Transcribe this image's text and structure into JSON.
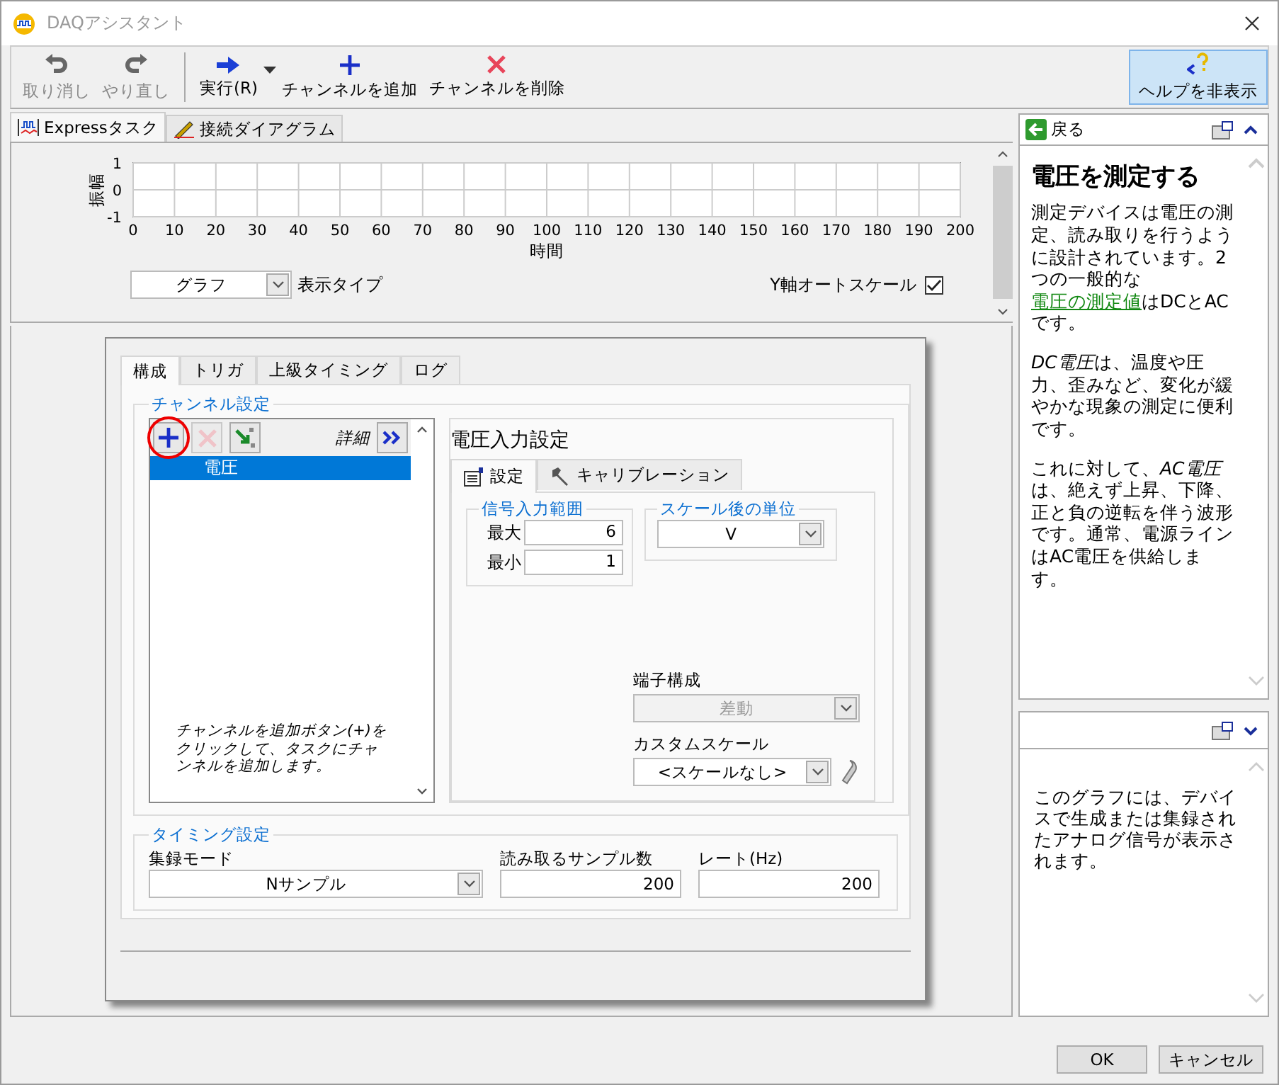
{
  "window": {
    "title": "DAQアシスタント"
  },
  "toolbar": {
    "items": [
      {
        "kind": "undo",
        "label": "取り消し",
        "disabled": true,
        "menu": false
      },
      {
        "kind": "redo",
        "label": "やり直し",
        "disabled": true,
        "menu": false
      },
      {
        "kind": "run",
        "label": "実行(R)",
        "disabled": false,
        "menu": true
      },
      {
        "kind": "add",
        "label": "チャンネルを追加",
        "disabled": false,
        "menu": false
      },
      {
        "kind": "delete",
        "label": "チャンネルを削除",
        "disabled": false,
        "menu": false
      }
    ],
    "help_toggle": {
      "label": "ヘルプを非表示",
      "selected": true
    }
  },
  "view_tabs": [
    {
      "kind": "express",
      "label": "Expressタスク",
      "selected": true
    },
    {
      "kind": "diagram",
      "label": "接続ダイアグラム",
      "selected": false
    }
  ],
  "graph": {
    "chart_data": {
      "type": "line",
      "xlabel": "時間",
      "ylabel": "振幅",
      "xlim": [
        0,
        200
      ],
      "ylim": [
        -1,
        1
      ],
      "xticks": [
        0,
        10,
        20,
        30,
        40,
        50,
        60,
        70,
        80,
        90,
        100,
        110,
        120,
        130,
        140,
        150,
        160,
        170,
        180,
        190,
        200
      ],
      "yticks": [
        -1,
        0,
        1
      ],
      "grid": true
    },
    "display_type": {
      "value": "グラフ",
      "label": "表示タイプ"
    },
    "autoscale": {
      "label": "Y軸オートスケール",
      "checked": true
    }
  },
  "config_tabs": [
    {
      "label": "構成",
      "selected": true
    },
    {
      "label": "トリガ",
      "selected": false
    },
    {
      "label": "上級タイミング",
      "selected": false
    },
    {
      "label": "ログ",
      "selected": false
    }
  ],
  "channel_settings": {
    "title": "チャンネル設定",
    "tools": [
      {
        "kind": "add",
        "disabled": false,
        "highlighted": true
      },
      {
        "kind": "delete",
        "disabled": true,
        "highlighted": false
      },
      {
        "kind": "import",
        "disabled": false,
        "highlighted": false
      }
    ],
    "details_label": "詳細",
    "channels": [
      {
        "name": "電圧",
        "selected": true
      }
    ],
    "hint": "チャンネルを追加ボタン(+)をクリックして、タスクにチャンネルを追加します。"
  },
  "voltage_input": {
    "title": "電圧入力設定",
    "tabs": [
      {
        "kind": "settings",
        "label": "設定",
        "selected": true
      },
      {
        "kind": "calibration",
        "label": "キャリブレーション",
        "selected": false
      }
    ],
    "signal_range": {
      "title": "信号入力範囲",
      "fields": [
        {
          "label": "最大",
          "value": "6"
        },
        {
          "label": "最小",
          "value": "1"
        }
      ]
    },
    "scaled_units": {
      "title": "スケール後の単位",
      "value": "V"
    },
    "terminal_config": {
      "label": "端子構成",
      "value": "差動",
      "disabled": true
    },
    "custom_scale": {
      "label": "カスタムスケール",
      "value": "<スケールなし>",
      "disabled": false
    }
  },
  "timing": {
    "title": "タイミング設定",
    "fields": [
      {
        "kind": "dropdown",
        "label": "集録モード",
        "value": "Nサンプル"
      },
      {
        "kind": "number",
        "label": "読み取るサンプル数",
        "value": "200"
      },
      {
        "kind": "number",
        "label": "レート(Hz)",
        "value": "200"
      }
    ]
  },
  "help": {
    "back": "戻る",
    "title": "電圧を測定する",
    "paragraphs": [
      {
        "segments": [
          {
            "kind": "plain",
            "text": "測定デバイスは電圧の測定、読み取りを行うように設計されています。2つの一般的な"
          },
          {
            "kind": "link",
            "text": "電圧の測定値"
          },
          {
            "kind": "plain",
            "text": "はDCとACです。"
          }
        ]
      },
      {
        "segments": [
          {
            "kind": "italic",
            "text": "DC電圧"
          },
          {
            "kind": "plain",
            "text": "は、温度や圧力、歪みなど、変化が緩やかな現象の測定に便利です。"
          }
        ]
      },
      {
        "segments": [
          {
            "kind": "plain",
            "text": "これに対して、"
          },
          {
            "kind": "italic",
            "text": "AC電圧"
          },
          {
            "kind": "plain",
            "text": "は、絶えず上昇、下降、正と負の逆転を伴う波形です。通常、電源ラインはAC電圧を供給します。"
          }
        ]
      }
    ]
  },
  "context_help": {
    "text": "このグラフには、デバイスで生成または集録されたアナログ信号が表示されます。"
  },
  "buttons": [
    "OK",
    "キャンセル"
  ]
}
